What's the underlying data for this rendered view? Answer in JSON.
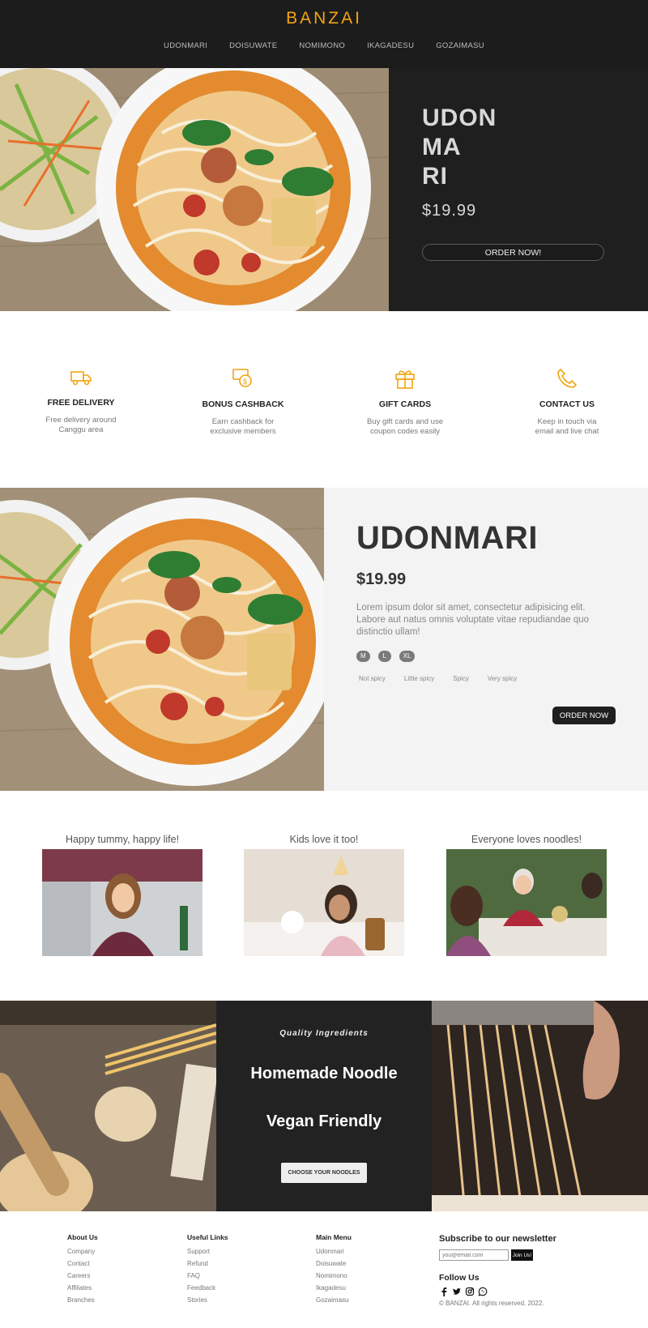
{
  "header": {
    "brand": "BANZAI",
    "nav": [
      "UDONMARI",
      "DOISUWATE",
      "NOMIMONO",
      "IKAGADESU",
      "GOZAIMASU"
    ]
  },
  "hero": {
    "title": "UDON\nMA\nRI",
    "price": "$19.99",
    "button": "ORDER NOW!"
  },
  "features": [
    {
      "icon": "truck-icon",
      "title": "FREE DELIVERY",
      "desc": "Free delivery around\nCanggu area"
    },
    {
      "icon": "cashback-icon",
      "title": "BONUS CASHBACK",
      "desc": "Earn cashback for\nexclusive members"
    },
    {
      "icon": "gift-icon",
      "title": "GIFT CARDS",
      "desc": "Buy gift cards and use\ncoupon codes easily"
    },
    {
      "icon": "phone-icon",
      "title": "CONTACT US",
      "desc": "Keep in touch via\nemail and live chat"
    }
  ],
  "product": {
    "title": "UDONMARI",
    "price": "$19.99",
    "description": "Lorem ipsum dolor sit amet, consectetur adipisicing elit. Labore aut natus omnis voluptate vitae repudiandae quo distinctio ullam!",
    "sizes": [
      "M",
      "L",
      "XL"
    ],
    "spice_levels": [
      "Not spicy",
      "Little spicy",
      "Spicy",
      "Very spicy"
    ],
    "button": "ORDER NOW"
  },
  "testimonials": [
    {
      "caption": "Happy tummy, happy life!"
    },
    {
      "caption": "Kids love it too!"
    },
    {
      "caption": "Everyone loves noodles!"
    }
  ],
  "quality": {
    "kicker": "Quality Ingredients",
    "line1": "Homemade Noodle",
    "line2": "Vegan Friendly",
    "button": "CHOOSE YOUR NOODLES"
  },
  "footer": {
    "columns": [
      {
        "title": "About Us",
        "links": [
          "Company",
          "Contact",
          "Careers",
          "Affiliates",
          "Branches"
        ]
      },
      {
        "title": "Useful Links",
        "links": [
          "Support",
          "Refund",
          "FAQ",
          "Feedback",
          "Stories"
        ]
      },
      {
        "title": "Main Menu",
        "links": [
          "Udonmari",
          "Doisuwate",
          "Nomimono",
          "Ikagadesu",
          "Gozaimasu"
        ]
      }
    ],
    "newsletter_title": "Subscribe to our newsletter",
    "email_placeholder": "you@email.com",
    "join_button": "Join Us!",
    "follow_title": "Follow Us",
    "socials": [
      "facebook-icon",
      "twitter-icon",
      "instagram-icon",
      "whatsapp-icon"
    ],
    "copyright": "© BANZAI. All rights reserved. 2022."
  },
  "colors": {
    "accent": "#f2a413",
    "dark": "#1f1f1f",
    "light": "#f3f3f3"
  }
}
